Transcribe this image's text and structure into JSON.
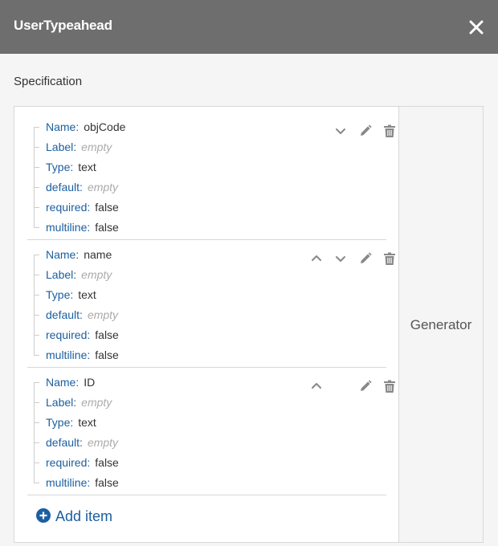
{
  "dialog": {
    "title": "UserTypeahead",
    "close_icon": "close-icon"
  },
  "spec": {
    "label": "Specification",
    "items": [
      {
        "fields": [
          {
            "key": "Name:",
            "value": "objCode",
            "empty": false
          },
          {
            "key": "Label:",
            "value": "empty",
            "empty": true
          },
          {
            "key": "Type:",
            "value": "text",
            "empty": false
          },
          {
            "key": "default:",
            "value": "empty",
            "empty": true
          },
          {
            "key": "required:",
            "value": "false",
            "empty": false
          },
          {
            "key": "multiline:",
            "value": "false",
            "empty": false
          }
        ],
        "actions": [
          "chevron-down-icon",
          "pencil-icon",
          "trash-icon"
        ]
      },
      {
        "fields": [
          {
            "key": "Name:",
            "value": "name",
            "empty": false
          },
          {
            "key": "Label:",
            "value": "empty",
            "empty": true
          },
          {
            "key": "Type:",
            "value": "text",
            "empty": false
          },
          {
            "key": "default:",
            "value": "empty",
            "empty": true
          },
          {
            "key": "required:",
            "value": "false",
            "empty": false
          },
          {
            "key": "multiline:",
            "value": "false",
            "empty": false
          }
        ],
        "actions": [
          "chevron-up-icon",
          "chevron-down-icon",
          "pencil-icon",
          "trash-icon"
        ]
      },
      {
        "fields": [
          {
            "key": "Name:",
            "value": "ID",
            "empty": false
          },
          {
            "key": "Label:",
            "value": "empty",
            "empty": true
          },
          {
            "key": "Type:",
            "value": "text",
            "empty": false
          },
          {
            "key": "default:",
            "value": "empty",
            "empty": true
          },
          {
            "key": "required:",
            "value": "false",
            "empty": false
          },
          {
            "key": "multiline:",
            "value": "false",
            "empty": false
          }
        ],
        "actions": [
          "chevron-up-icon",
          "pencil-icon",
          "trash-icon"
        ]
      }
    ],
    "add_item_label": "Add item",
    "add_item_icon": "plus-circle-icon"
  },
  "generator": {
    "label": "Generator"
  },
  "colors": {
    "titlebar": "#6e6e6e",
    "key_text": "#1b5fa0",
    "value_text": "#333333",
    "empty_text": "#aaaaaa",
    "icon_gray": "#888888"
  }
}
